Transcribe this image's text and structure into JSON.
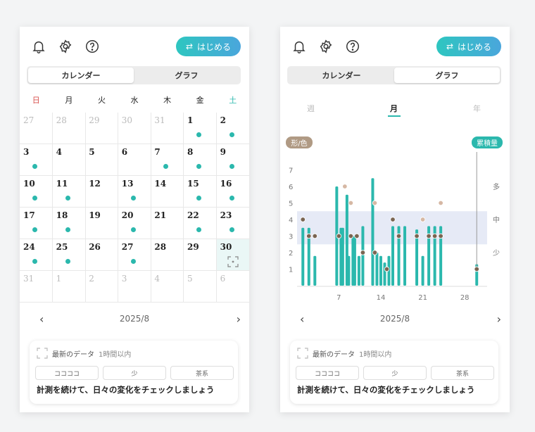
{
  "top": {
    "start_label": "はじめる",
    "swap_glyph": "⇄"
  },
  "tabs": {
    "calendar": "カレンダー",
    "graph": "グラフ"
  },
  "calendar": {
    "weekdays": [
      "日",
      "月",
      "火",
      "水",
      "木",
      "金",
      "土"
    ],
    "weeks": [
      [
        {
          "d": "27",
          "o": true
        },
        {
          "d": "28",
          "o": true
        },
        {
          "d": "29",
          "o": true
        },
        {
          "d": "30",
          "o": true
        },
        {
          "d": "31",
          "o": true
        },
        {
          "d": "1",
          "dot": true
        },
        {
          "d": "2",
          "dot": true
        }
      ],
      [
        {
          "d": "3",
          "dot": true
        },
        {
          "d": "4"
        },
        {
          "d": "5"
        },
        {
          "d": "6"
        },
        {
          "d": "7",
          "dot": true
        },
        {
          "d": "8",
          "dot": true
        },
        {
          "d": "9",
          "dot": true
        }
      ],
      [
        {
          "d": "10",
          "dot": true
        },
        {
          "d": "11",
          "dot": true
        },
        {
          "d": "12"
        },
        {
          "d": "13",
          "dot": true
        },
        {
          "d": "14"
        },
        {
          "d": "15",
          "dot": true
        },
        {
          "d": "16",
          "dot": true
        }
      ],
      [
        {
          "d": "17",
          "dot": true
        },
        {
          "d": "18",
          "dot": true
        },
        {
          "d": "19"
        },
        {
          "d": "20",
          "dot": true
        },
        {
          "d": "21"
        },
        {
          "d": "22",
          "dot": true
        },
        {
          "d": "23",
          "dot": true
        }
      ],
      [
        {
          "d": "24",
          "dot": true
        },
        {
          "d": "25",
          "dot": true
        },
        {
          "d": "26"
        },
        {
          "d": "27",
          "dot": true
        },
        {
          "d": "28"
        },
        {
          "d": "29"
        },
        {
          "d": "30",
          "today": true
        }
      ],
      [
        {
          "d": "31",
          "o": true
        },
        {
          "d": "1",
          "o": true
        },
        {
          "d": "2",
          "o": true
        },
        {
          "d": "3",
          "o": true
        },
        {
          "d": "4",
          "o": true
        },
        {
          "d": "5",
          "o": true
        },
        {
          "d": "6",
          "o": true
        }
      ]
    ],
    "month_label": "2025/8"
  },
  "card": {
    "title": "最新のデータ",
    "subtitle": "1時間以内",
    "chips": [
      "ココココ",
      "少",
      "茶系"
    ],
    "message": "計測を続けて、日々の変化をチェックしましょう"
  },
  "graph": {
    "periods": [
      "週",
      "月",
      "年"
    ],
    "badge_shape": "形/色",
    "badge_total": "累積量",
    "month_label": "2025/8"
  },
  "colors": {
    "accent": "#2bb8ad",
    "brown": "#b09a84",
    "brown_dark": "#7a6552",
    "band": "#e6eaf6"
  },
  "chart_data": {
    "type": "bar",
    "y_left_ticks": [
      "1",
      "2",
      "3",
      "4",
      "5",
      "6",
      "7"
    ],
    "y_right_labels": [
      "少",
      "中",
      "多"
    ],
    "x_tick_labels": [
      "7",
      "14",
      "21",
      "28"
    ],
    "ylim": [
      0,
      8
    ],
    "x": [
      1,
      2,
      3,
      7,
      8,
      9,
      10,
      11,
      13,
      14,
      15,
      16,
      17,
      18,
      20,
      21,
      22,
      23,
      24,
      30
    ],
    "bars": [
      [
        3.5
      ],
      [
        3.5
      ],
      [
        1.8
      ],
      [
        6,
        3.5
      ],
      [
        3.5,
        5.5
      ],
      [
        1.8,
        3
      ],
      [
        3,
        1.8
      ],
      [
        3.6
      ],
      [
        6.5,
        2
      ],
      [
        1.8
      ],
      [
        1.4,
        1.8
      ],
      [
        3.6
      ],
      [
        3.6
      ],
      [
        3.6
      ],
      [
        3.4
      ],
      [
        1.8
      ],
      [
        3.6
      ],
      [
        3.6
      ],
      [
        3.6
      ],
      [
        1.3
      ]
    ],
    "points": [
      {
        "x": 1,
        "y": 4,
        "c": "dark"
      },
      {
        "x": 2,
        "y": 3,
        "c": "dark"
      },
      {
        "x": 3,
        "y": 3,
        "c": "dark"
      },
      {
        "x": 7,
        "y": 3,
        "c": "dark"
      },
      {
        "x": 8,
        "y": 6,
        "c": "light"
      },
      {
        "x": 9,
        "y": 5,
        "c": "light"
      },
      {
        "x": 9,
        "y": 3,
        "c": "dark"
      },
      {
        "x": 10,
        "y": 3,
        "c": "dark"
      },
      {
        "x": 11,
        "y": 2,
        "c": "dark"
      },
      {
        "x": 13,
        "y": 5,
        "c": "light"
      },
      {
        "x": 13,
        "y": 2,
        "c": "dark"
      },
      {
        "x": 15,
        "y": 1,
        "c": "dark"
      },
      {
        "x": 16,
        "y": 4,
        "c": "dark"
      },
      {
        "x": 17,
        "y": 3,
        "c": "dark"
      },
      {
        "x": 20,
        "y": 3,
        "c": "dark"
      },
      {
        "x": 21,
        "y": 4,
        "c": "light"
      },
      {
        "x": 22,
        "y": 3,
        "c": "dark"
      },
      {
        "x": 23,
        "y": 3,
        "c": "dark"
      },
      {
        "x": 24,
        "y": 5,
        "c": "light"
      },
      {
        "x": 24,
        "y": 3,
        "c": "dark"
      },
      {
        "x": 30,
        "y": 1,
        "c": "dark"
      }
    ],
    "band_y": [
      2.5,
      4.5
    ]
  }
}
